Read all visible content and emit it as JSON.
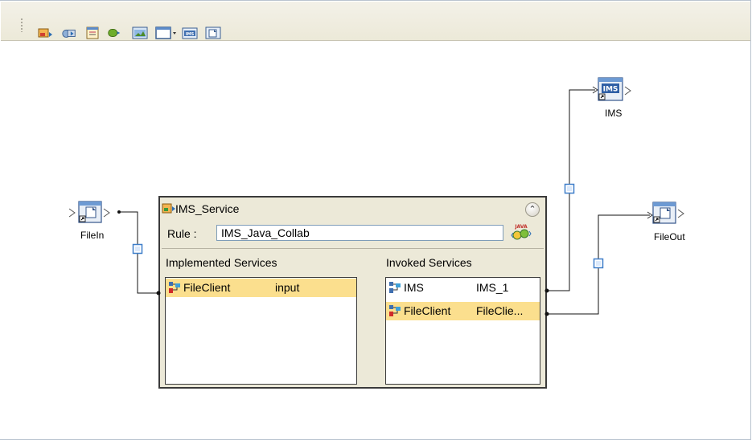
{
  "toolbar": {
    "buttons": [
      {
        "name": "service-tool-icon"
      },
      {
        "name": "web-service-tool-icon"
      },
      {
        "name": "external-application-tool-icon"
      },
      {
        "name": "queue-tool-icon"
      },
      {
        "name": "scheduler-tool-icon"
      },
      {
        "name": "window-dropdown-tool-icon"
      },
      {
        "name": "ims-tool-icon"
      },
      {
        "name": "file-tool-icon"
      }
    ],
    "ims_button_text": "IMS"
  },
  "nodes": {
    "file_in": {
      "label": "FileIn"
    },
    "ims": {
      "label": "IMS",
      "icon_text": "IMS"
    },
    "file_out": {
      "label": "FileOut"
    }
  },
  "service": {
    "title": "IMS_Service",
    "rule_label": "Rule :",
    "rule_value": "IMS_Java_Collab",
    "java_badge": "JAVA",
    "implemented_header": "Implemented Services",
    "invoked_header": "Invoked Services",
    "implemented": [
      {
        "name": "FileClient",
        "value": "input",
        "selected": true
      }
    ],
    "invoked": [
      {
        "name": "IMS",
        "value": "IMS_1",
        "selected": false
      },
      {
        "name": "FileClient",
        "value": "FileClie...",
        "selected": true
      }
    ]
  },
  "colors": {
    "selection": "#fbdf8e",
    "panel": "#ece9d8",
    "link_box": "#3e7ec9"
  }
}
